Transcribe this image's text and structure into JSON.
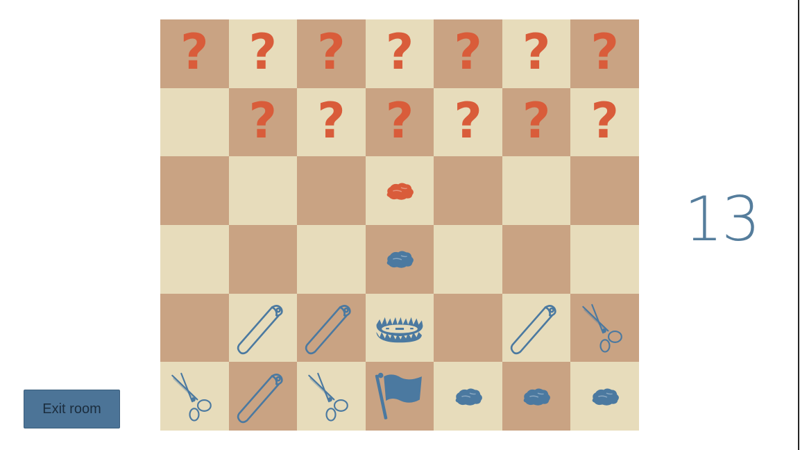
{
  "counter": "13",
  "exit_button": {
    "label": "Exit room"
  },
  "colors": {
    "dark_square": "#c9a383",
    "light_square": "#e7dcbb",
    "opponent_red": "#d95c3a",
    "player_blue": "#4b79a0"
  },
  "board": {
    "rows": 6,
    "cols": 7,
    "pieces": [
      [
        "hidden",
        "hidden",
        "hidden",
        "hidden",
        "hidden",
        "hidden",
        "hidden"
      ],
      [
        "empty",
        "hidden",
        "hidden",
        "hidden",
        "hidden",
        "hidden",
        "hidden"
      ],
      [
        "empty",
        "empty",
        "empty",
        "rock-red",
        "empty",
        "empty",
        "empty"
      ],
      [
        "empty",
        "empty",
        "empty",
        "rock-blue",
        "empty",
        "empty",
        "empty"
      ],
      [
        "empty",
        "paper-blue",
        "paper-blue",
        "trap-blue",
        "empty",
        "paper-blue",
        "scissors-blue"
      ],
      [
        "scissors-blue",
        "paper-blue",
        "scissors-blue",
        "flag-blue",
        "rock-blue",
        "rock-blue",
        "rock-blue"
      ]
    ],
    "hidden_symbol": "?"
  }
}
